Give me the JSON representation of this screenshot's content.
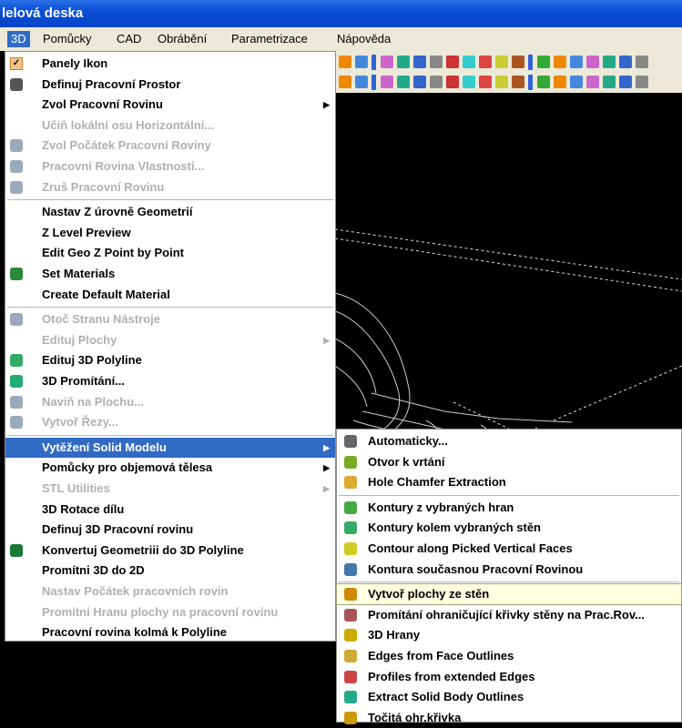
{
  "title": "lelová deska",
  "menubar": [
    "3D",
    "Pomůcky",
    "CAD",
    "Obrábění",
    "Parametrizace",
    "Nápověda"
  ],
  "menu3d": [
    {
      "label": "Panely Ikon",
      "icon": "check-icon",
      "color": "#e08010",
      "dis": false
    },
    {
      "label": "Definuj Pracovní Prostor",
      "icon": "workspace-icon",
      "color": "#555",
      "dis": false
    },
    {
      "label": "Zvol Pracovní Rovinu",
      "icon": "",
      "dis": false,
      "arrow": true
    },
    {
      "label": "Učiň lokální osu Horizontální...",
      "icon": "",
      "dis": true
    },
    {
      "label": "Zvol Počátek Pracovní Roviny",
      "icon": "origin-icon",
      "color": "#9ab",
      "dis": true
    },
    {
      "label": "Pracovní Rovina Vlastnosti...",
      "icon": "plane-properties-icon",
      "color": "#9ab",
      "dis": true
    },
    {
      "label": "Zruš Pracovní Rovinu",
      "icon": "cancel-plane-icon",
      "color": "#9ab",
      "dis": true
    },
    {
      "sep": true
    },
    {
      "label": "Nastav Z úrovně Geometrií",
      "icon": "",
      "dis": false
    },
    {
      "label": "Z Level Preview",
      "icon": "",
      "dis": false
    },
    {
      "label": "Edit Geo Z Point by Point",
      "icon": "",
      "dis": false
    },
    {
      "label": "Set Materials",
      "icon": "material-icon",
      "color": "#2a8a3a",
      "dis": false
    },
    {
      "label": "Create Default Material",
      "icon": "",
      "dis": false
    },
    {
      "sep": true
    },
    {
      "label": "Otoč Stranu Nástroje",
      "icon": "flip-tool-icon",
      "color": "#9ab",
      "dis": true
    },
    {
      "label": "Edituj Plochy",
      "icon": "",
      "dis": true,
      "arrow": true
    },
    {
      "label": "Edituj 3D Polyline",
      "icon": "polyline-icon",
      "color": "#3a6",
      "dis": false
    },
    {
      "label": "3D Promítání...",
      "icon": "projection-icon",
      "color": "#2a7",
      "dis": false
    },
    {
      "label": "Naviň na Plochu...",
      "icon": "wrap-icon",
      "color": "#9ab",
      "dis": true
    },
    {
      "label": "Vytvoř Řezy...",
      "icon": "sections-icon",
      "color": "#9ab",
      "dis": true
    },
    {
      "sep": true
    },
    {
      "label": "Vytěžení Solid Modelu",
      "icon": "",
      "dis": false,
      "arrow": true,
      "hl": true
    },
    {
      "label": "Pomůcky pro objemová tělesa",
      "icon": "",
      "dis": false,
      "arrow": true
    },
    {
      "label": "STL Utilities",
      "icon": "",
      "dis": true,
      "arrow": true
    },
    {
      "label": "3D Rotace dílu",
      "icon": "",
      "dis": false
    },
    {
      "label": "Definuj 3D Pracovní rovinu",
      "icon": "",
      "dis": false
    },
    {
      "label": "Konvertuj Geometriii do 3D Polyline",
      "icon": "convert-icon",
      "color": "#1a7a3a",
      "dis": false
    },
    {
      "label": "Promítni 3D do 2D",
      "icon": "",
      "dis": false
    },
    {
      "label": "Nastav Počátek pracovních rovin",
      "icon": "",
      "dis": true
    },
    {
      "label": "Promítni Hranu plochy na pracovní rovinu",
      "icon": "",
      "dis": true
    },
    {
      "label": "Pracovní rovina kolmá k Polyline",
      "icon": "",
      "dis": false
    }
  ],
  "submenu": [
    {
      "label": "Automaticky...",
      "icon": "auto-icon",
      "color": "#666"
    },
    {
      "label": "Otvor k vrtání",
      "icon": "hole-icon",
      "color": "#7a2"
    },
    {
      "label": "Hole Chamfer Extraction",
      "icon": "chamfer-icon",
      "color": "#da3"
    },
    {
      "sep": true
    },
    {
      "label": "Kontury z vybraných hran",
      "icon": "contour-edges-icon",
      "color": "#4a4"
    },
    {
      "label": "Kontury kolem vybraných stěn",
      "icon": "contour-faces-icon",
      "color": "#3a6"
    },
    {
      "label": "Contour along Picked Vertical Faces",
      "icon": "vertical-faces-icon",
      "color": "#cc2"
    },
    {
      "label": "Kontura současnou Pracovní Rovinou",
      "icon": "contour-plane-icon",
      "color": "#47a"
    },
    {
      "sep": true
    },
    {
      "label": "Vytvoř plochy ze stěn",
      "icon": "surfaces-from-faces-icon",
      "color": "#c80",
      "hl": true
    },
    {
      "label": "Promítání ohraničující křivky stěny na Prac.Rov...",
      "icon": "project-boundary-icon",
      "color": "#a55"
    },
    {
      "label": "3D Hrany",
      "icon": "edges-3d-icon",
      "color": "#ca0"
    },
    {
      "label": "Edges from Face Outlines",
      "icon": "face-outline-icon",
      "color": "#ca3"
    },
    {
      "label": "Profiles from extended Edges",
      "icon": "profiles-icon",
      "color": "#c44"
    },
    {
      "label": "Extract Solid Body Outlines",
      "icon": "solid-outline-icon",
      "color": "#2a8"
    },
    {
      "label": "Točitá ohr.křivka",
      "icon": "spiral-icon",
      "color": "#c90"
    }
  ]
}
